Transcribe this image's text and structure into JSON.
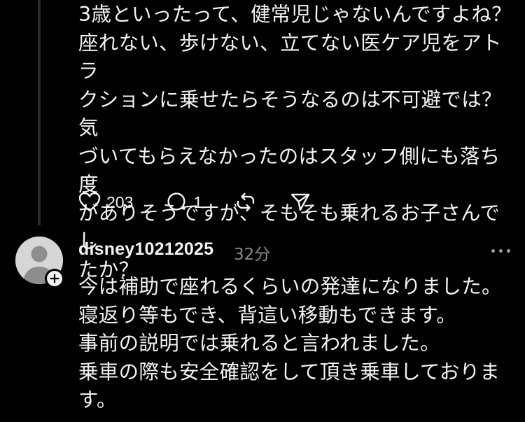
{
  "parent_post": {
    "text": "3歳といったって、健常児じゃないんですよね？\n座れない、歩けない、立てない医ケア児をアトラ\nクションに乗せたらそうなるのは不可避では？気\nづいてもらえなかったのはスタッフ側にも落ち度\nがありそうですが、そもそも乗れるお子さんでし\nたか？",
    "likes": "203",
    "replies": "1"
  },
  "reply_post": {
    "username": "disney10212025",
    "timestamp": "32分",
    "text": "今は補助で座れるくらいの発達になりました。\n寝返り等もでき、背這い移動もできます。\n事前の説明では乗れると言われました。\n乗車の際も安全確認をして頂き乗車しておりま\nす。"
  },
  "icons": {
    "like": "heart-icon",
    "reply": "comment-icon",
    "repost": "repost-icon",
    "share": "send-icon",
    "more": "more-icon",
    "avatar": "default-avatar",
    "follow": "plus-icon"
  },
  "colors": {
    "background": "#000000",
    "text": "#f3f3f3",
    "muted": "#8a8a8a",
    "thread_line": "#2b2b2b"
  }
}
